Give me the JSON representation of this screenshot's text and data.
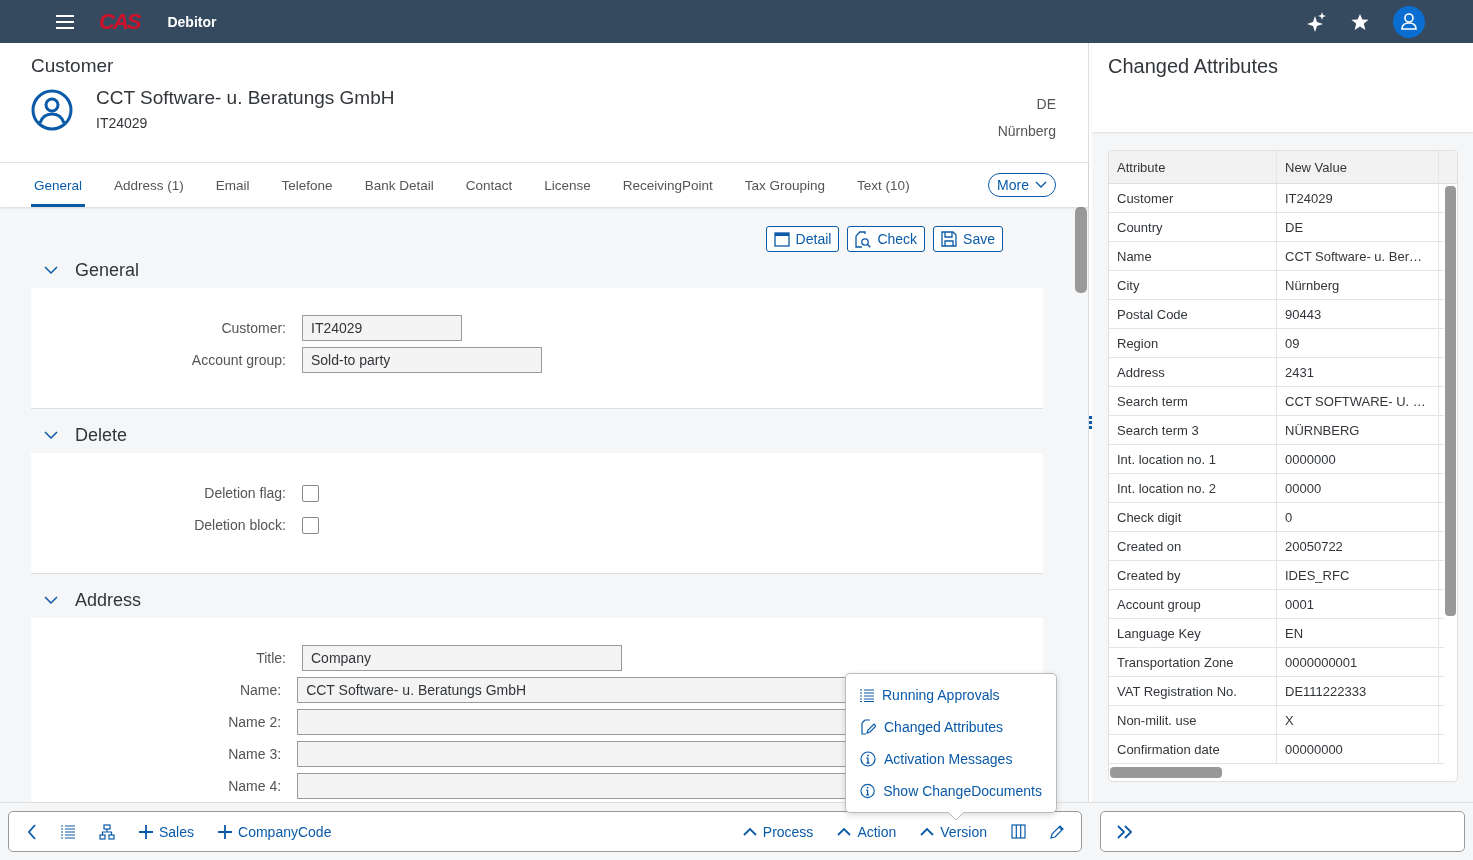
{
  "shell": {
    "logo": "CAS",
    "title": "Debitor"
  },
  "header": {
    "kind_label": "Customer",
    "name": "CCT Software- u. Beratungs GmbH",
    "id": "IT24029",
    "country": "DE",
    "city": "Nürnberg"
  },
  "tabs": [
    {
      "label": "General",
      "selected": true
    },
    {
      "label": "Address (1)",
      "selected": false
    },
    {
      "label": "Email",
      "selected": false
    },
    {
      "label": "Telefone",
      "selected": false
    },
    {
      "label": "Bank Detail",
      "selected": false
    },
    {
      "label": "Contact",
      "selected": false
    },
    {
      "label": "License",
      "selected": false
    },
    {
      "label": "ReceivingPoint",
      "selected": false
    },
    {
      "label": "Tax Grouping",
      "selected": false
    },
    {
      "label": "Text (10)",
      "selected": false
    }
  ],
  "more_button": "More",
  "actions": [
    "Detail",
    "Check",
    "Save"
  ],
  "sections": [
    {
      "title": "General",
      "expanded": true,
      "fields": [
        {
          "kind": "input",
          "label": "Customer:",
          "value": "IT24029"
        },
        {
          "kind": "input",
          "label": "Account group:",
          "value": "Sold-to party"
        }
      ]
    },
    {
      "title": "Delete",
      "expanded": true,
      "fields": [
        {
          "kind": "checkbox",
          "label": "Deletion flag:",
          "checked": false
        },
        {
          "kind": "checkbox",
          "label": "Deletion block:",
          "checked": false
        }
      ]
    },
    {
      "title": "Address",
      "expanded": true,
      "fields": [
        {
          "kind": "input",
          "label": "Title:",
          "value": "Company"
        },
        {
          "kind": "input",
          "label": "Name:",
          "value": "CCT Software- u. Beratungs GmbH"
        },
        {
          "kind": "input",
          "label": "Name 2:"
        },
        {
          "kind": "input",
          "label": "Name 3:"
        },
        {
          "kind": "input",
          "label": "Name 4:"
        }
      ]
    }
  ],
  "footer": {
    "buttons": [
      {
        "kind": "add",
        "label": "Sales"
      },
      {
        "kind": "add",
        "label": "CompanyCode"
      }
    ],
    "menus": [
      {
        "label": "Process"
      },
      {
        "label": "Action"
      },
      {
        "label": "Version"
      }
    ]
  },
  "popover": {
    "items": [
      "Running Approvals",
      "Changed Attributes",
      "Activation Messages",
      "Show ChangeDocuments"
    ]
  },
  "side_panel": {
    "title": "Changed Attributes",
    "table": {
      "columns": [
        "Attribute",
        "New Value"
      ],
      "rows": [
        [
          "Customer",
          "IT24029"
        ],
        [
          "Country",
          "DE"
        ],
        [
          "Name",
          "CCT Software- u. Ber…"
        ],
        [
          "City",
          "Nürnberg"
        ],
        [
          "Postal Code",
          "90443"
        ],
        [
          "Region",
          "09"
        ],
        [
          "Address",
          "2431"
        ],
        [
          "Search term",
          "CCT SOFTWARE- U. …"
        ],
        [
          "Search term 3",
          "NÜRNBERG"
        ],
        [
          "Int. location no. 1",
          "0000000"
        ],
        [
          "Int. location no. 2",
          "00000"
        ],
        [
          "Check digit",
          "0"
        ],
        [
          "Created on",
          "20050722"
        ],
        [
          "Created by",
          "IDES_RFC"
        ],
        [
          "Account group",
          "0001"
        ],
        [
          "Language Key",
          "EN"
        ],
        [
          "Transportation Zone",
          "0000000001"
        ],
        [
          "VAT Registration No.",
          "DE111222333"
        ],
        [
          "Non-milit. use",
          "X"
        ],
        [
          "Confirmation date",
          "00000000"
        ]
      ]
    }
  }
}
